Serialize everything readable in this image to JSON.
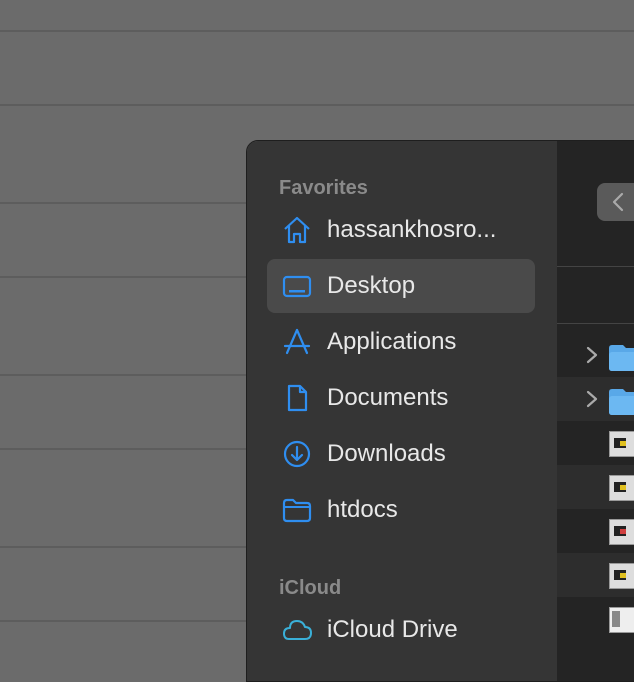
{
  "sidebar": {
    "sections": [
      {
        "title": "Favorites",
        "items": [
          {
            "label": "hassankhosro...",
            "icon": "home-icon",
            "selected": false
          },
          {
            "label": "Desktop",
            "icon": "desktop-icon",
            "selected": true
          },
          {
            "label": "Applications",
            "icon": "applications-icon",
            "selected": false
          },
          {
            "label": "Documents",
            "icon": "document-icon",
            "selected": false
          },
          {
            "label": "Downloads",
            "icon": "download-icon",
            "selected": false
          },
          {
            "label": "htdocs",
            "icon": "folder-icon",
            "selected": false
          }
        ]
      },
      {
        "title": "iCloud",
        "items": [
          {
            "label": "iCloud Drive",
            "icon": "cloud-icon",
            "selected": false
          }
        ]
      }
    ]
  },
  "colors": {
    "accent": "#2f8ef0",
    "sidebar_bg": "#353535",
    "selected_bg": "#4a4a4a",
    "content_bg": "#242424"
  },
  "content": {
    "rows": [
      {
        "kind": "folder",
        "icon": "folder-icon"
      },
      {
        "kind": "folder",
        "icon": "folder-icon"
      },
      {
        "kind": "file",
        "icon": "image-thumbnail"
      },
      {
        "kind": "file",
        "icon": "image-thumbnail"
      },
      {
        "kind": "file",
        "icon": "image-thumbnail"
      },
      {
        "kind": "file",
        "icon": "image-thumbnail"
      },
      {
        "kind": "file",
        "icon": "image-thumbnail"
      }
    ]
  }
}
